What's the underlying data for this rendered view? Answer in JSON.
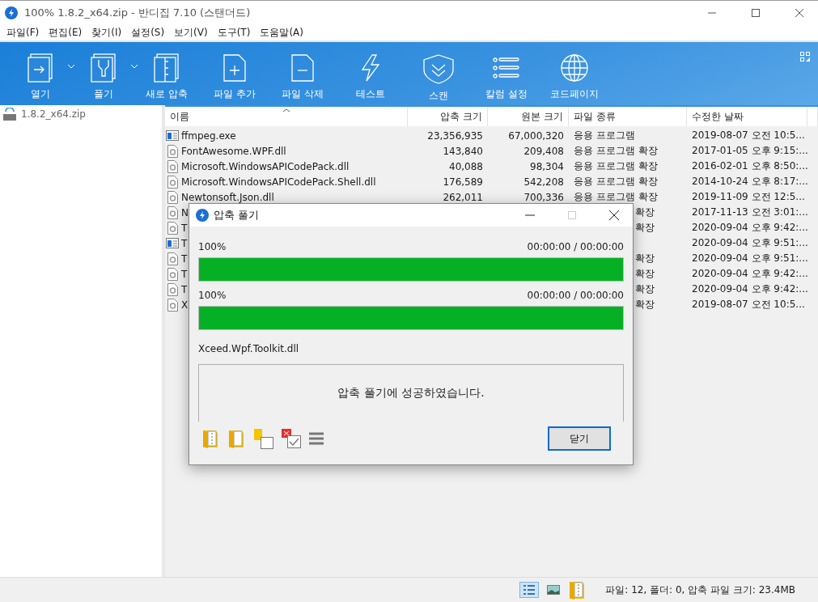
{
  "window": {
    "title": "100% 1.8.2_x64.zip - 반디집 7.10 (스탠더드)"
  },
  "menu": [
    "파일(F)",
    "편집(E)",
    "찾기(I)",
    "설정(S)",
    "보기(V)",
    "도구(T)",
    "도움말(A)"
  ],
  "toolbar": [
    {
      "label": "열기",
      "dropdown": true
    },
    {
      "label": "풀기",
      "dropdown": true
    },
    {
      "label": "새로 압축",
      "dropdown": false
    },
    {
      "label": "파일 추가",
      "dropdown": false
    },
    {
      "label": "파일 삭제",
      "dropdown": false
    },
    {
      "label": "테스트",
      "dropdown": false
    },
    {
      "label": "스캔",
      "dropdown": false
    },
    {
      "label": "칼럼 설정",
      "dropdown": false
    },
    {
      "label": "코드페이지",
      "dropdown": false
    }
  ],
  "sidebar": {
    "items": [
      {
        "label": "1.8.2_x64.zip",
        "selected": false
      }
    ]
  },
  "table": {
    "columns": [
      "이름",
      "압축 크기",
      "원본 크기",
      "파일 종류",
      "수정한 날짜"
    ],
    "rows": [
      {
        "kind": "exe",
        "covered": false,
        "name": "ffmpeg.exe",
        "packed": "23,356,935",
        "size": "67,000,320",
        "type": "응용 프로그램",
        "date": "2019-08-07 오전 10:5..."
      },
      {
        "kind": "dll",
        "covered": false,
        "name": "FontAwesome.WPF.dll",
        "packed": "143,840",
        "size": "209,408",
        "type": "응용 프로그램 확장",
        "date": "2017-01-05 오후 9:15:..."
      },
      {
        "kind": "dll",
        "covered": false,
        "name": "Microsoft.WindowsAPICodePack.dll",
        "packed": "40,088",
        "size": "98,304",
        "type": "응용 프로그램 확장",
        "date": "2016-02-01 오후 8:50:..."
      },
      {
        "kind": "dll",
        "covered": false,
        "name": "Microsoft.WindowsAPICodePack.Shell.dll",
        "packed": "176,589",
        "size": "542,208",
        "type": "응용 프로그램 확장",
        "date": "2014-10-24 오후 8:17:..."
      },
      {
        "kind": "dll",
        "covered": false,
        "name": "Newtonsoft.Json.dll",
        "packed": "262,011",
        "size": "700,336",
        "type": "응용 프로그램 확장",
        "date": "2019-11-09 오전 12:5..."
      },
      {
        "kind": "dll",
        "covered": true,
        "name": "N",
        "type": "확장",
        "date": "2017-11-13 오전 3:01:..."
      },
      {
        "kind": "dll",
        "covered": true,
        "name": "T",
        "type": "확장",
        "date": "2020-09-04 오후 9:42:..."
      },
      {
        "kind": "exe",
        "name": "T",
        "date": "2020-09-04 오후 9:51:..."
      },
      {
        "kind": "dll",
        "covered": true,
        "name": "T",
        "type": "확장",
        "date": "2020-09-04 오후 9:51:..."
      },
      {
        "kind": "dll",
        "covered": true,
        "name": "T",
        "type": "확장",
        "date": "2020-09-04 오후 9:42:..."
      },
      {
        "kind": "dll",
        "covered": true,
        "name": "T",
        "type": "확장",
        "date": "2020-09-04 오후 9:42:..."
      },
      {
        "kind": "dll",
        "covered": true,
        "name": "X",
        "type": "확장",
        "date": "2019-08-07 오전 10:5..."
      }
    ]
  },
  "dialog": {
    "title": "압축 풀기",
    "progress": [
      {
        "percent": "100%",
        "time": "00:00:00 / 00:00:00",
        "level": 1
      },
      {
        "percent": "100%",
        "time": "00:00:00 / 00:00:00",
        "level": 1
      }
    ],
    "current_file": "Xceed.Wpf.Toolkit.dll",
    "message": "압축 풀기에 성공하였습니다.",
    "close_button": "닫기"
  },
  "status_bar": {
    "views": [
      {
        "selected": true
      },
      {
        "selected": false
      }
    ],
    "text": "파일: 12, 폴더: 0, 압축 파일 크기: 23.4MB"
  }
}
